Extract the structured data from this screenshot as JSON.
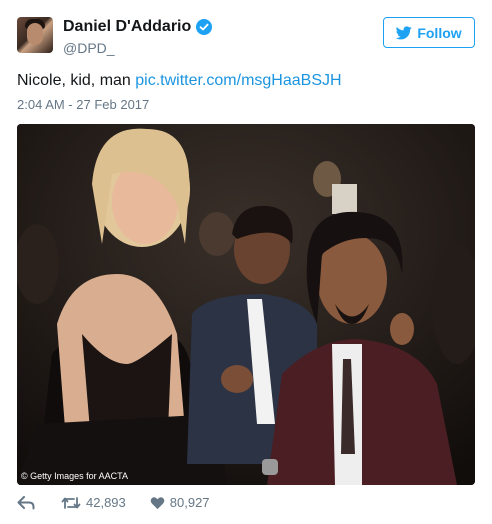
{
  "user": {
    "display_name": "Daniel D'Addario",
    "handle": "@DPD_",
    "avatar_icon": "profile-photo"
  },
  "follow_button": {
    "label": "Follow",
    "icon": "twitter-bird-icon"
  },
  "tweet": {
    "text": "Nicole, kid, man ",
    "link": "pic.twitter.com/msgHaaBSJH",
    "timestamp": "2:04 AM - 27 Feb 2017"
  },
  "photo": {
    "credit": "© Getty Images for AACTA"
  },
  "actions": {
    "reply_icon": "reply-icon",
    "retweet_icon": "retweet-icon",
    "retweet_count": "42,893",
    "like_icon": "heart-icon",
    "like_count": "80,927"
  },
  "colors": {
    "accent": "#1da1f2",
    "link": "#1b95e0",
    "muted": "#657786",
    "text": "#14171a"
  }
}
